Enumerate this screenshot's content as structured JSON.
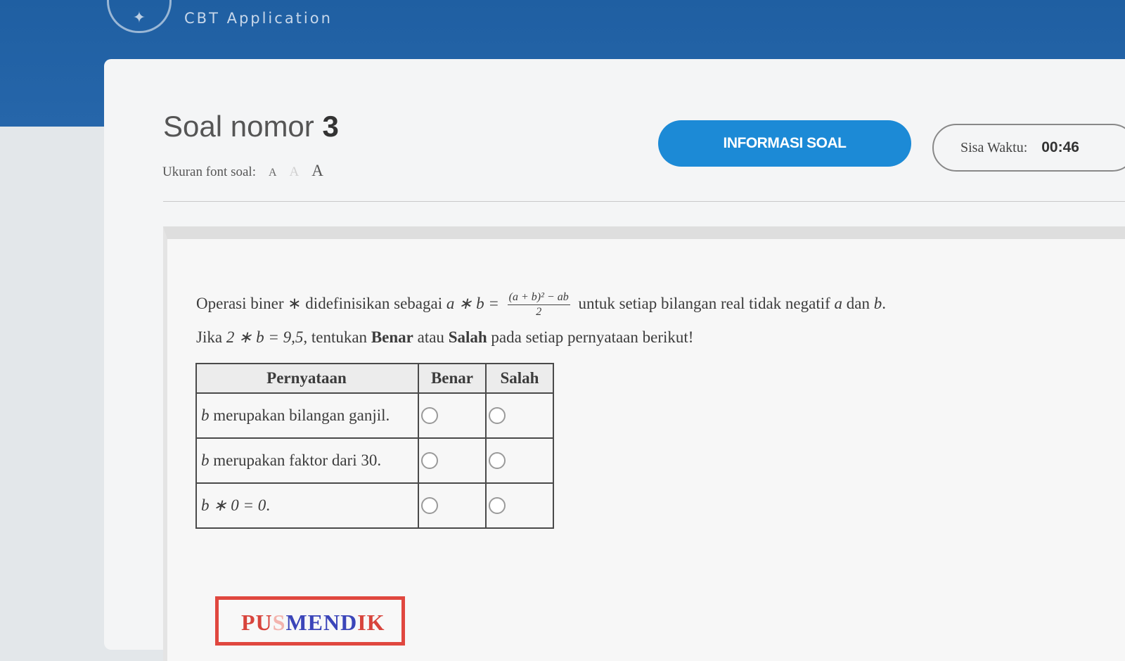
{
  "header": {
    "app_subtitle": "CBT Application"
  },
  "question": {
    "title_prefix": "Soal nomor",
    "number": "3",
    "font_size_label": "Ukuran font soal:",
    "font_size_options": [
      "A",
      "A",
      "A"
    ],
    "intro_1": "Operasi biner ∗ didefinisikan sebagai",
    "formula_lhs": "a ∗ b =",
    "formula_num": "(a + b)² − ab",
    "formula_den": "2",
    "intro_2": "untuk setiap bilangan real tidak negatif",
    "var_a": "a",
    "and": "dan",
    "var_b": "b",
    "period": ".",
    "line2_prefix": "Jika",
    "line2_math": "2 ∗ b = 9,5",
    "line2_mid": ", tentukan",
    "benar_word": "Benar",
    "atau": "atau",
    "salah_word": "Salah",
    "line2_suffix": "pada setiap pernyataan berikut!"
  },
  "buttons": {
    "info": "INFORMASI SOAL"
  },
  "timer": {
    "label": "Sisa Waktu:",
    "value": "00:46"
  },
  "table": {
    "headers": [
      "Pernyataan",
      "Benar",
      "Salah"
    ],
    "rows": [
      {
        "var": "b",
        "text": " merupakan bilangan ganjil."
      },
      {
        "var": "b",
        "text": " merupakan faktor dari 30."
      },
      {
        "var": "b ∗ 0 = 0",
        "text": "."
      }
    ]
  },
  "watermark": {
    "a": "PU",
    "b": "S",
    "c": "MEND",
    "d": "IK"
  }
}
